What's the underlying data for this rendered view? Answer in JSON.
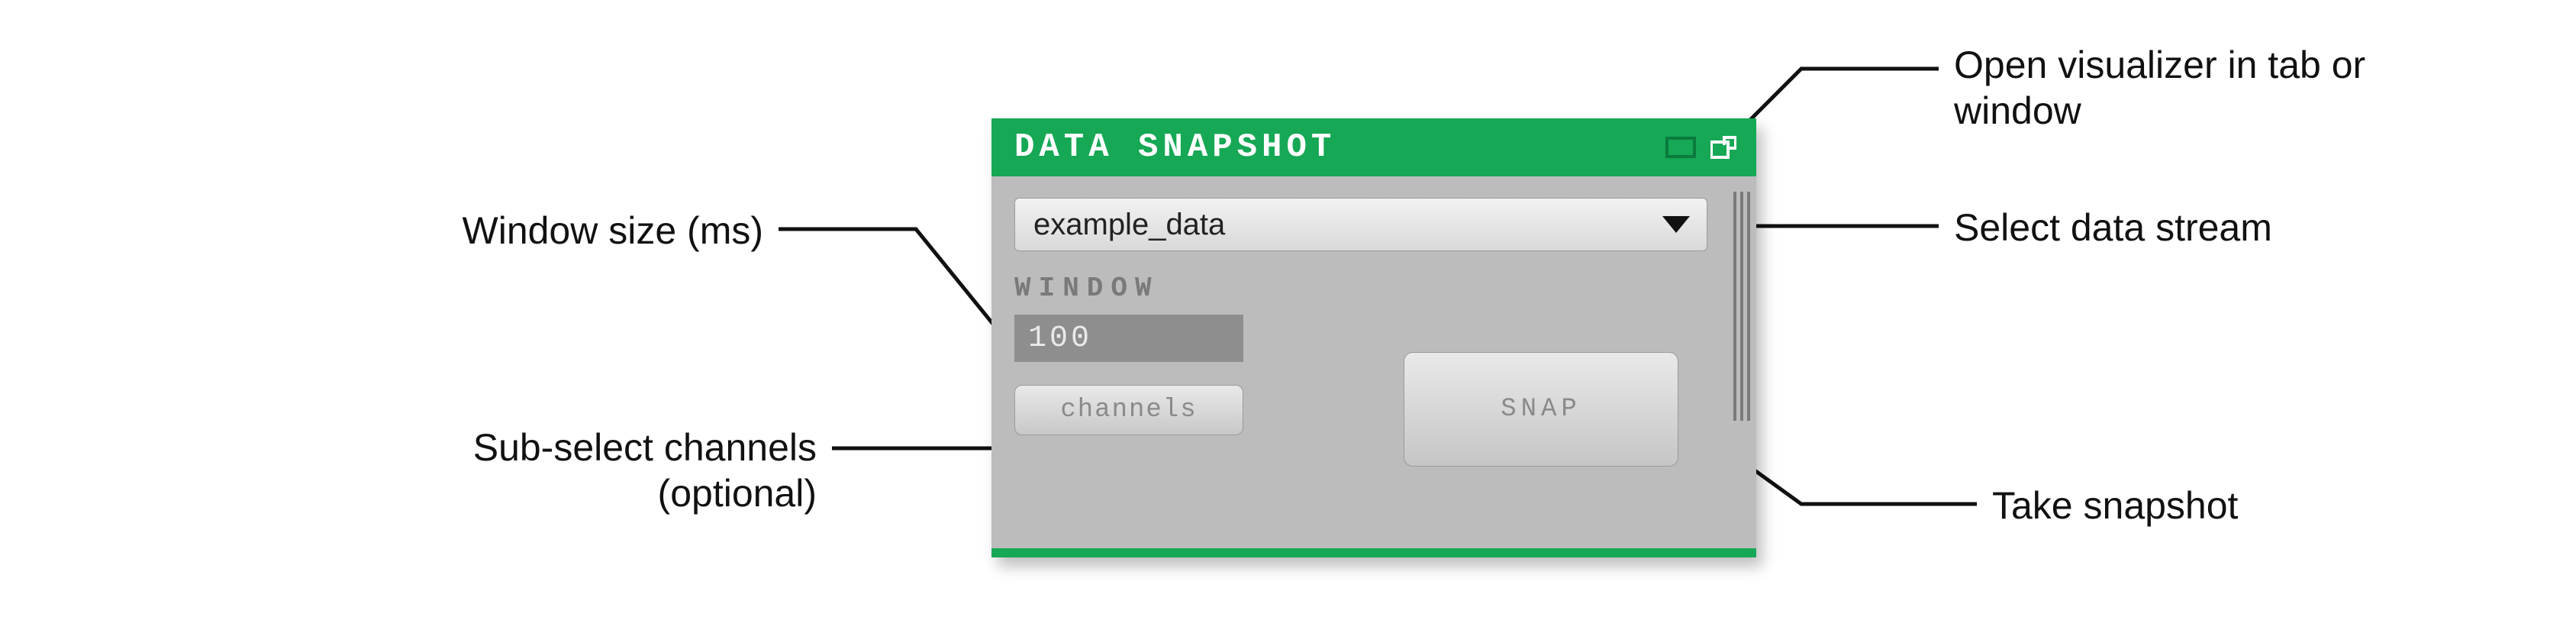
{
  "panel": {
    "title": "DATA SNAPSHOT",
    "dropdown_value": "example_data",
    "window_label": "WINDOW",
    "window_value": "100",
    "channels_label": "channels",
    "snap_label": "SNAP"
  },
  "annotations": {
    "open_visualizer": "Open visualizer in tab or window",
    "select_stream": "Select data stream",
    "take_snapshot": "Take snapshot",
    "window_size": "Window size (ms)",
    "sub_select": "Sub-select channels (optional)"
  },
  "colors": {
    "accent": "#16a855",
    "panel_bg": "#bcbcbc"
  }
}
